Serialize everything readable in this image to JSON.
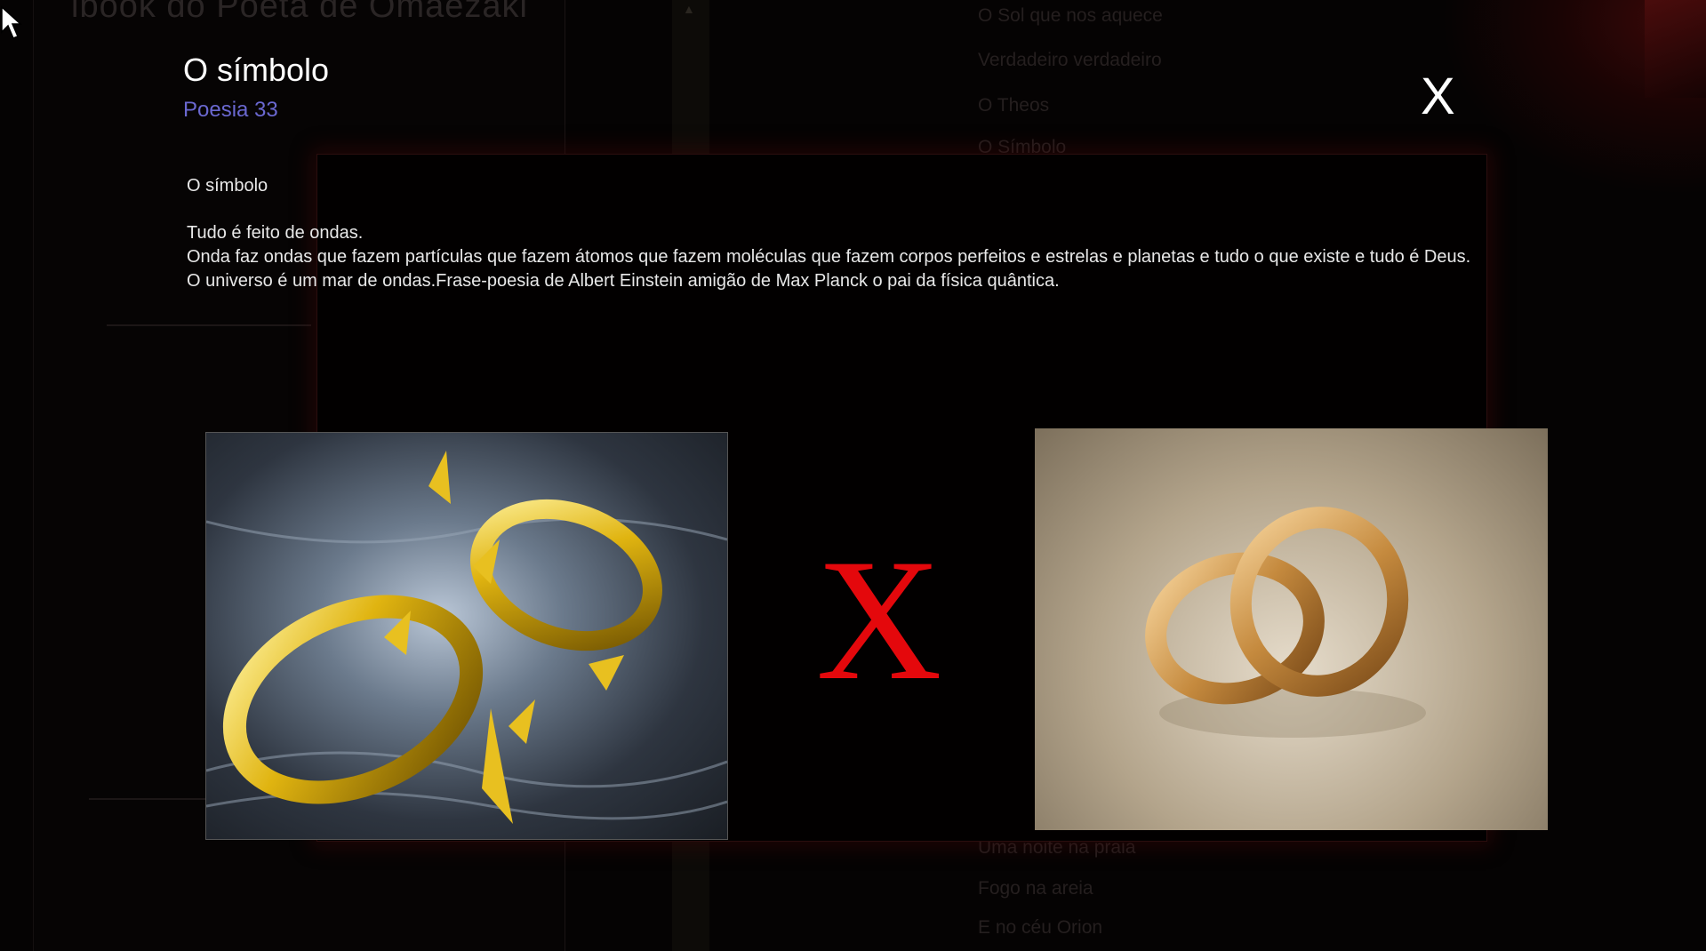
{
  "background": {
    "app_title": "ibook do Poeta de Omaezaki",
    "list_items": [
      "O Sol que nos aquece",
      "Verdadeiro  verdadeiro",
      "O Theos",
      "O Símbolo",
      "Uma noite na praia",
      "Fogo na areia",
      "E no céu Orion"
    ]
  },
  "poem": {
    "title": "O símbolo",
    "subtitle": "Poesia 33",
    "heading": "O símbolo",
    "lines": [
      "Tudo é feito de ondas.",
      "Onda faz ondas que fazem partículas que fazem átomos que fazem moléculas que fazem corpos perfeitos e estrelas e planetas e tudo o que existe e tudo é Deus.",
      "O universo é um mar de ondas.Frase-poesia de Albert Einstein amigão de Max Planck o pai da física quântica."
    ]
  },
  "controls": {
    "close_label": "X"
  },
  "images": {
    "left": "broken-gold-ring-image",
    "right": "interlocked-gold-rings-image",
    "separator": "X"
  },
  "colors": {
    "separator": "#e4080c",
    "subtitle": "#6a68d0"
  }
}
